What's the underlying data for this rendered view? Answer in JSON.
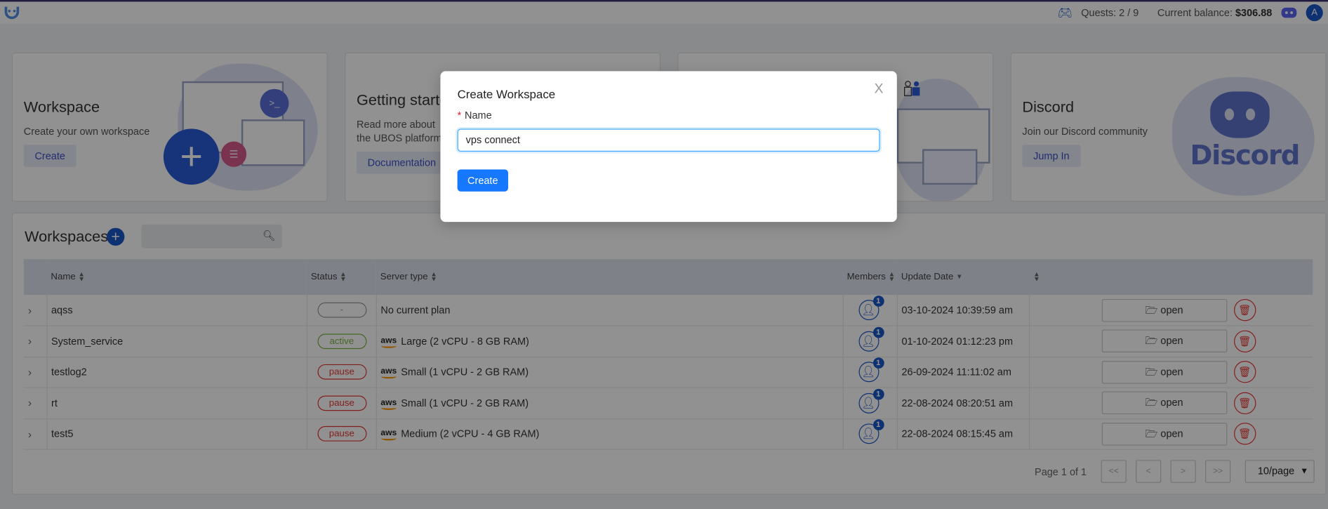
{
  "topbar": {
    "quests": "Quests: 2 / 9",
    "balance_label": "Current balance:",
    "balance_value": "$306.88",
    "avatar_initial": "A"
  },
  "cards": [
    {
      "title": "Workspace",
      "text": "Create your own workspace",
      "button": "Create"
    },
    {
      "title": "Getting started",
      "text": "Read more about the UBOS platform",
      "button": "Documentation"
    },
    {
      "title": "",
      "text": "",
      "button": ""
    },
    {
      "title": "Discord",
      "text": "Join our Discord community",
      "button": "Jump In",
      "logo_text": "Discord"
    }
  ],
  "workspaces": {
    "title": "Workspaces",
    "search_placeholder": "",
    "columns": [
      "Name",
      "Status",
      "Server type",
      "Members",
      "Update Date",
      ""
    ],
    "rows": [
      {
        "name": "aqss",
        "status": "-",
        "status_kind": "none",
        "server": "No current plan",
        "aws": false,
        "members": "1",
        "date": "03-10-2024 10:39:59 am",
        "open": "open"
      },
      {
        "name": "System_service",
        "status": "active",
        "status_kind": "active",
        "server": "Large (2 vCPU - 8 GB RAM)",
        "aws": true,
        "members": "1",
        "date": "01-10-2024 01:12:23 pm",
        "open": "open"
      },
      {
        "name": "testlog2",
        "status": "pause",
        "status_kind": "pause",
        "server": "Small (1 vCPU - 2 GB RAM)",
        "aws": true,
        "members": "1",
        "date": "26-09-2024 11:11:02 am",
        "open": "open"
      },
      {
        "name": "rt",
        "status": "pause",
        "status_kind": "pause",
        "server": "Small (1 vCPU - 2 GB RAM)",
        "aws": true,
        "members": "1",
        "date": "22-08-2024 08:20:51 am",
        "open": "open"
      },
      {
        "name": "test5",
        "status": "pause",
        "status_kind": "pause",
        "server": "Medium (2 vCPU - 4 GB RAM)",
        "aws": true,
        "members": "1",
        "date": "22-08-2024 08:15:45 am",
        "open": "open"
      }
    ],
    "pagination": {
      "page_text": "Page 1 of 1",
      "first": "<<",
      "prev": "<",
      "next": ">",
      "last": ">>",
      "page_size": "10/page"
    }
  },
  "modal": {
    "title": "Create Workspace",
    "close": "X",
    "field_label": "Name",
    "required_mark": "*",
    "field_value": "vps connect",
    "submit": "Create"
  },
  "colors": {
    "primary": "#1677ff",
    "brand": "#1a57c9",
    "active": "#7cb342",
    "pause": "#e53935"
  }
}
